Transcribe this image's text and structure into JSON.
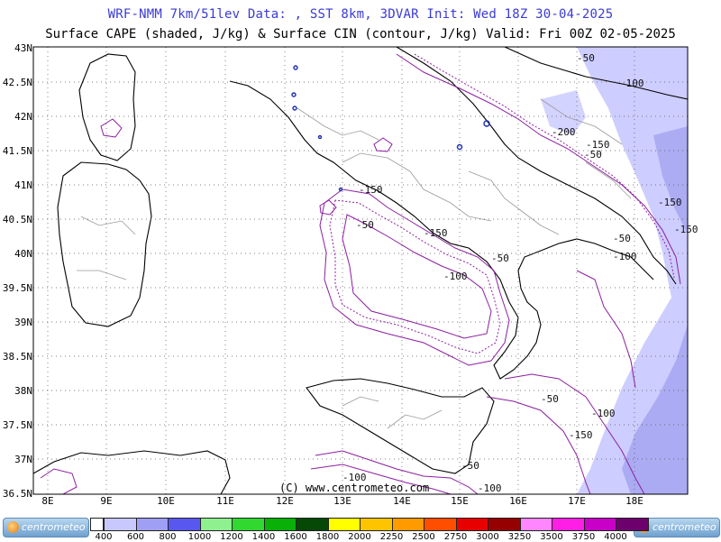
{
  "header": {
    "title": "WRF-NMM 7km/51lev  Data: , SST 8km, 3DVAR  Init: Wed 18Z 30-04-2025",
    "subtitle": "Surface CAPE (shaded, J/kg) & Surface CIN (contour, J/kg)  Valid: Fri 00Z 02-05-2025"
  },
  "axes": {
    "lat_labels": [
      "43N",
      "42.5N",
      "42N",
      "41.5N",
      "41N",
      "40.5N",
      "40N",
      "39.5N",
      "39N",
      "38.5N",
      "38N",
      "37.5N",
      "37N",
      "36.5N"
    ],
    "lon_labels": [
      "8E",
      "9E",
      "10E",
      "11E",
      "12E",
      "13E",
      "14E",
      "15E",
      "16E",
      "17E",
      "18E"
    ]
  },
  "cin_labels": [
    "-50",
    "-100",
    "-200",
    "-150",
    "-50",
    "-150",
    "-50",
    "-150",
    "-100",
    "-150",
    "-50",
    "-100",
    "-50",
    "-100",
    "-150",
    "-50",
    "-100",
    "-50",
    "-100",
    "-150"
  ],
  "copyright": "(C) www.centrometeo.com",
  "colorbar": {
    "labels": [
      "400",
      "600",
      "800",
      "1000",
      "1200",
      "1400",
      "1600",
      "1800",
      "2000",
      "2250",
      "2500",
      "2750",
      "3000",
      "3250",
      "3500",
      "3750",
      "4000"
    ],
    "colors": [
      "#c8c8ff",
      "#9f9ff5",
      "#5858f0",
      "#8ef08e",
      "#30d830",
      "#08b008",
      "#064806",
      "#ffff00",
      "#ffc400",
      "#ff9a00",
      "#ff4e00",
      "#e80000",
      "#960000",
      "#ff86ff",
      "#ff1ee6",
      "#c800c8",
      "#6e006e"
    ]
  },
  "branding": {
    "left_logo": "centrometeo",
    "right_logo": "centrometeo"
  },
  "colors": {
    "title": "#3a3ad8",
    "cin_contour": "#8c1fa0",
    "cape_low": "#c8c8ff",
    "cape_mid": "#9f9ff5"
  }
}
